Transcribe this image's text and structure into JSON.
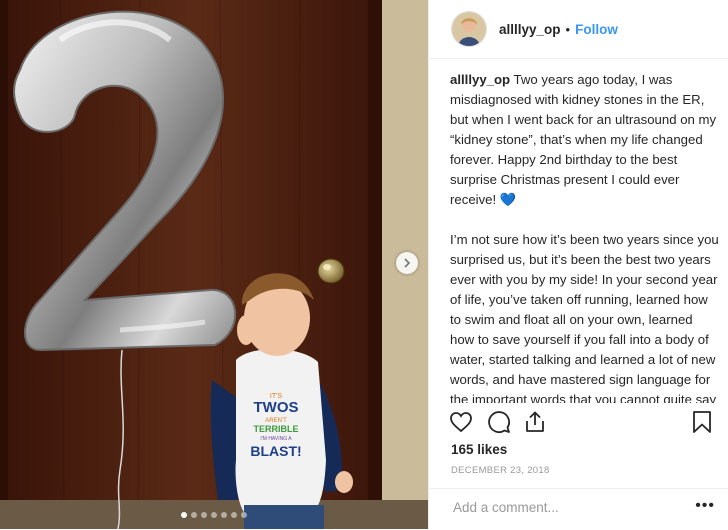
{
  "post": {
    "username": "allllyy_op",
    "follow_label": "Follow",
    "separator": "•",
    "caption_text": "Two years ago today, I was misdiagnosed with kidney stones in the ER, but when I went back for an ultrasound on my “kidney stone”, that’s when my life changed forever. Happy 2nd birthday to the best surprise Christmas present I could ever receive! 💙\n\nI’m not sure how it’s been two years since you surprised us, but it’s been the best two years ever with you by my side! In your second year of life, you’ve taken off running, learned how to swim and float all on your own, learned how to save yourself if you fall into a body of water, started talking and learned a lot of new words, and have mastered sign language for the important words that you cannot quite say yet. You’ve shown us so much love and happiness and have taught me so much yourself. You’ve traveled all over the",
    "likes": "165 likes",
    "date": "DECEMBER 23, 2018",
    "comment_placeholder": "Add a comment...",
    "more_label": "•••"
  },
  "photo": {
    "balloon_number": "2",
    "shirt_text": {
      "line1": "IT'S",
      "line2": "TWOS",
      "line3": "AREN'T",
      "line4": "TERRIBLE",
      "line5": "I'M HAVING A",
      "line6": "BLAST!"
    },
    "carousel": {
      "total": 7,
      "active": 1
    }
  },
  "colors": {
    "accent": "#3897f0",
    "door": "#4a1f12",
    "wall": "#c6b796"
  },
  "icons": {
    "heart": "heart-icon",
    "comment": "comment-icon",
    "share": "share-icon",
    "bookmark": "bookmark-icon",
    "next": "chevron-right-icon"
  }
}
